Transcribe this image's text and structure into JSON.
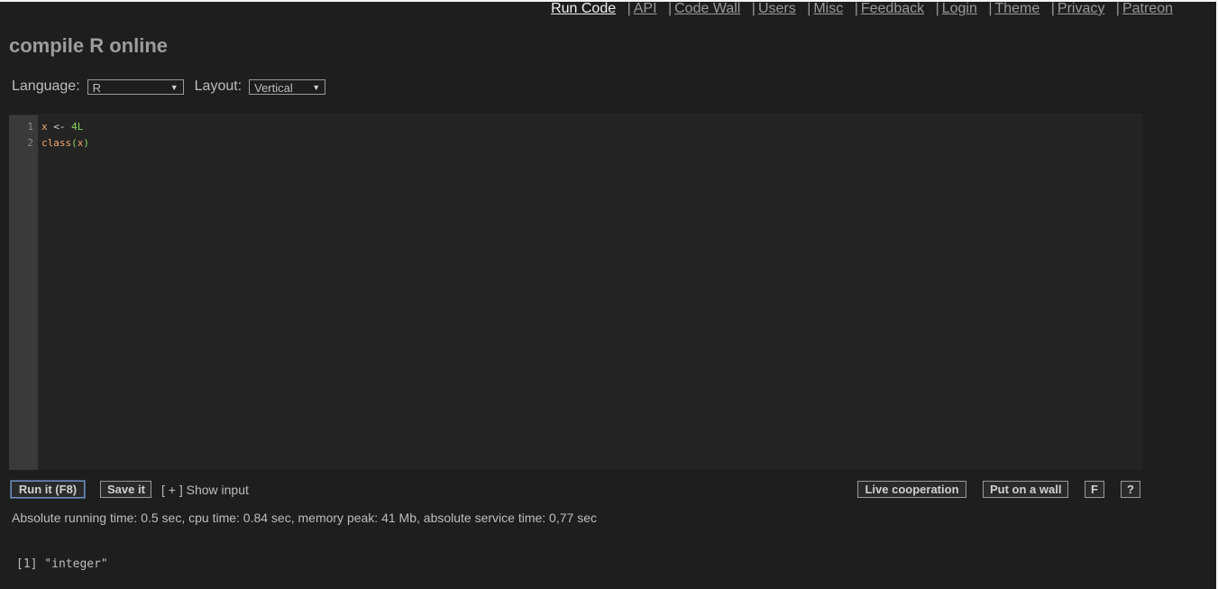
{
  "nav": {
    "items": [
      {
        "label": "Run Code"
      },
      {
        "label": "API"
      },
      {
        "label": "Code Wall"
      },
      {
        "label": "Users"
      },
      {
        "label": "Misc"
      },
      {
        "label": "Feedback"
      },
      {
        "label": "Login"
      },
      {
        "label": "Theme"
      },
      {
        "label": "Privacy"
      },
      {
        "label": "Patreon"
      }
    ],
    "separator": "|"
  },
  "page": {
    "title": "compile R online"
  },
  "controls": {
    "language_label": "Language:",
    "language_value": "R",
    "layout_label": "Layout:",
    "layout_value": "Vertical",
    "arrow_glyph": "▼"
  },
  "editor": {
    "lines": [
      {
        "num": "1",
        "tokens": [
          "x",
          " <- ",
          "4L"
        ]
      },
      {
        "num": "2",
        "tokens": [
          "class",
          "(",
          "x",
          ")"
        ]
      }
    ]
  },
  "actions": {
    "run_label": "Run it (F8)",
    "save_label": "Save it",
    "show_input_label": "[ + ] Show input",
    "live_coop_label": "Live cooperation",
    "wall_label": "Put on a wall",
    "f_label": "F",
    "help_label": "?"
  },
  "stats": {
    "text": "Absolute running time: 0.5 sec, cpu time: 0.84 sec, memory peak: 41 Mb, absolute service time: 0,77 sec"
  },
  "output": {
    "text": "[1] \"integer\""
  },
  "colors": {
    "background": "#1e1e1e",
    "editor_bg": "#242424",
    "gutter_bg": "#3a3a3a",
    "keyword": "#f0a96d",
    "number": "#8bd25a"
  }
}
